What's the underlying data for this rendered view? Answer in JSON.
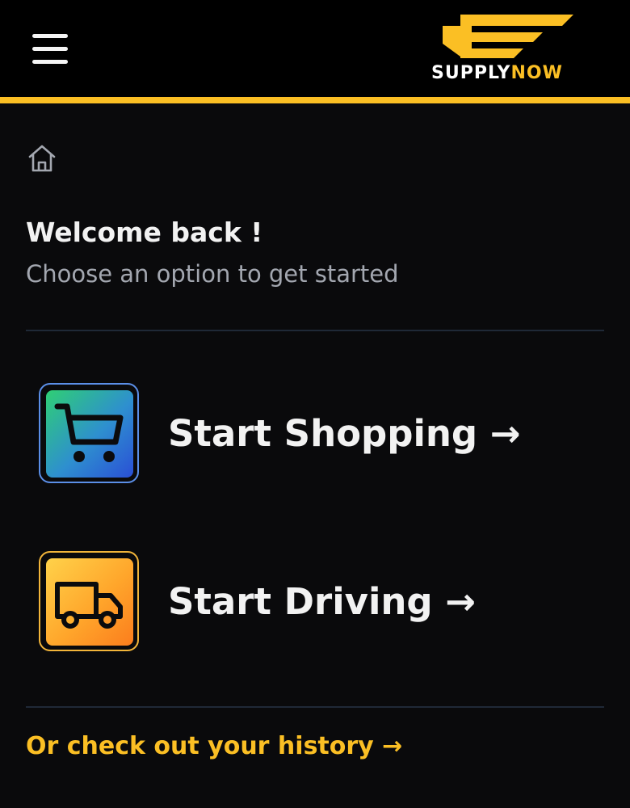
{
  "header": {
    "menu_icon": "hamburger-menu-icon",
    "logo": {
      "icon": "supplynow-logo-mark",
      "text_primary": "SUPPLY",
      "text_accent": "NOW"
    }
  },
  "breadcrumb": {
    "home_icon": "home-icon"
  },
  "welcome": {
    "title": "Welcome back !",
    "subtitle": "Choose an option to get started"
  },
  "options": [
    {
      "label": "Start Shopping →",
      "icon": "shopping-cart-icon"
    },
    {
      "label": "Start Driving →",
      "icon": "delivery-truck-icon"
    }
  ],
  "history_link": "Or check out your history →",
  "colors": {
    "background": "#0a0a0c",
    "accent": "#fbbf24",
    "text_primary": "#f2f2f2",
    "text_muted": "#a3a7b0",
    "divider": "#1f2937"
  }
}
